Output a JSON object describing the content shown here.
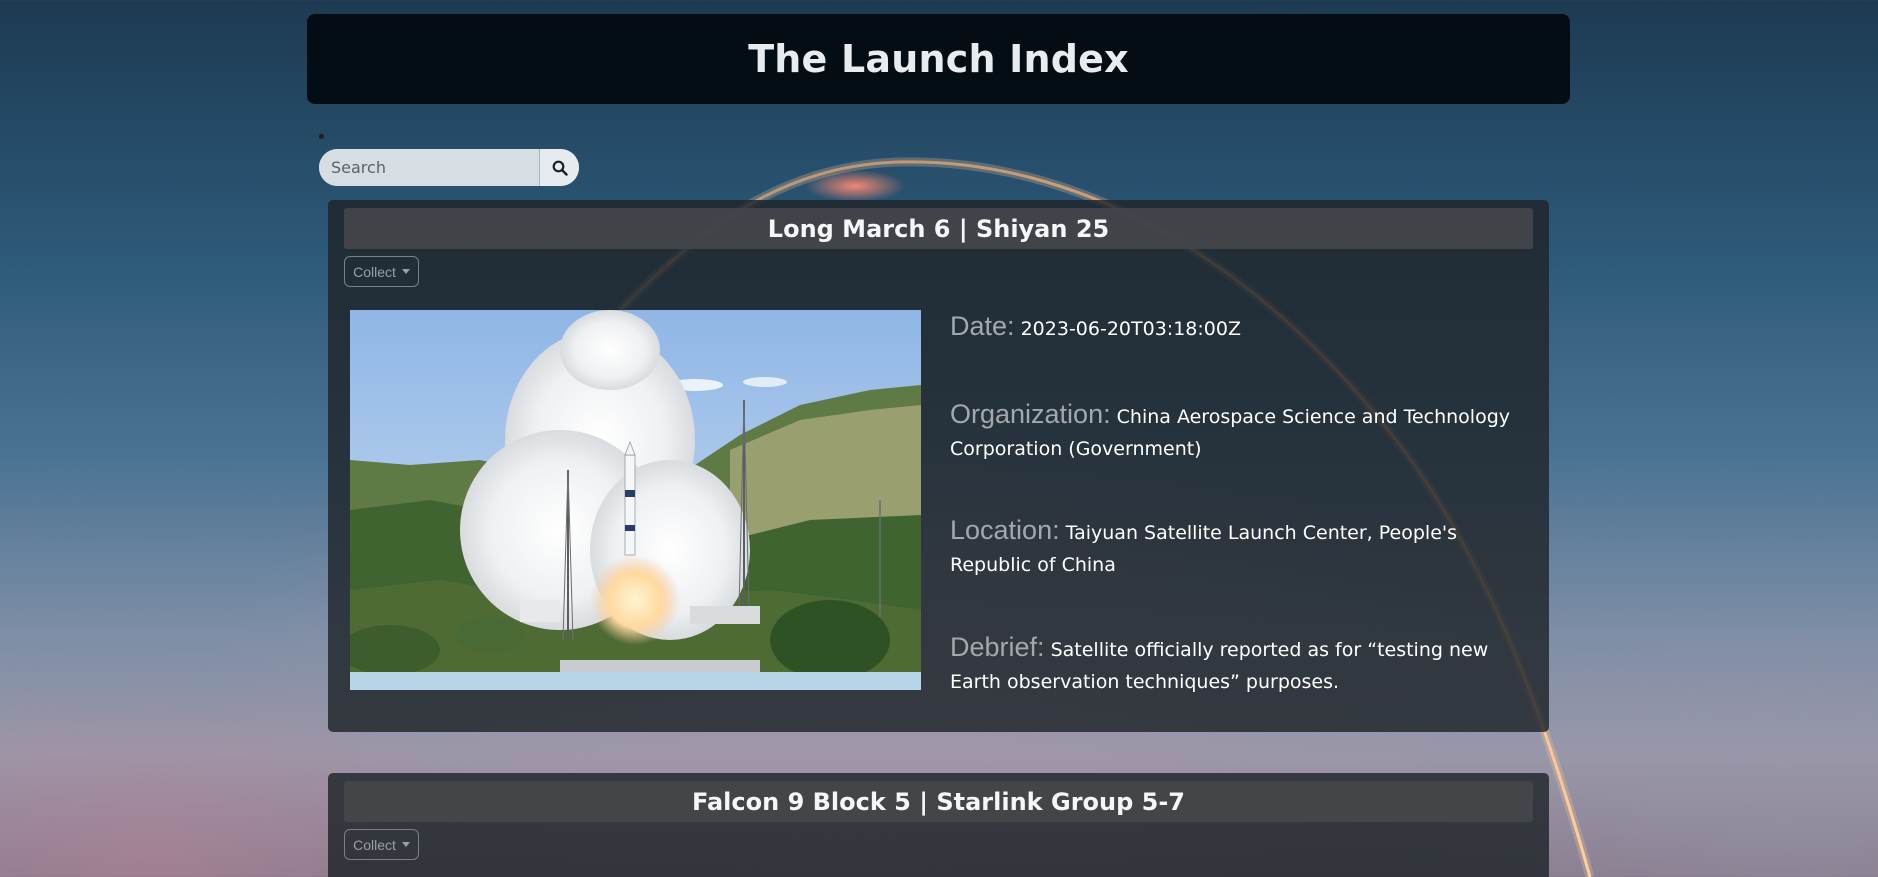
{
  "header": {
    "title": "The Launch Index"
  },
  "search": {
    "placeholder": "Search",
    "button_icon": "search-icon"
  },
  "launches": [
    {
      "title": "Long March 6 | Shiyan 25",
      "collect_label": "Collect",
      "image_alt": "Long March 6 rocket launching from pad",
      "date_label": "Date:",
      "date": "2023-06-20T03:18:00Z",
      "organization_label": "Organization:",
      "organization": "China Aerospace Science and Technology Corporation (Government)",
      "location_label": "Location:",
      "location": "Taiyuan Satellite Launch Center, People's Republic of China",
      "debrief_label": "Debrief:",
      "debrief": "Satellite officially reported as for “testing new Earth observation techniques” purposes."
    },
    {
      "title": "Falcon 9 Block 5 | Starlink Group 5-7",
      "collect_label": "Collect"
    }
  ]
}
